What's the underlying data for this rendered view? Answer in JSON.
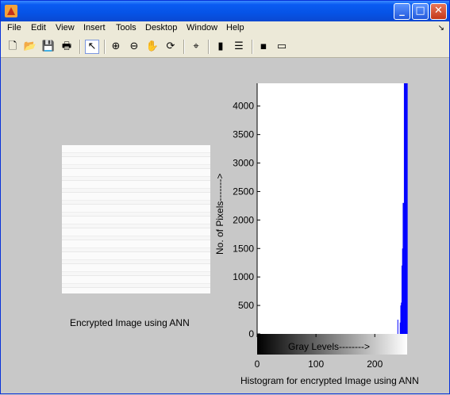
{
  "menu": {
    "items": [
      "File",
      "Edit",
      "View",
      "Insert",
      "Tools",
      "Desktop",
      "Window",
      "Help"
    ],
    "overflow_icon": "dock-arrow-icon"
  },
  "toolbar": {
    "tools": [
      "new-figure-icon",
      "open-file-icon",
      "save-icon",
      "print-icon",
      "select-arrow-icon",
      "zoom-in-icon",
      "zoom-out-icon",
      "pan-hand-icon",
      "rotate-3d-icon",
      "data-cursor-icon",
      "insert-colorbar-icon",
      "insert-legend-icon",
      "hide-plot-tools-icon",
      "show-plot-tools-icon"
    ]
  },
  "left_panel": {
    "caption": "Encrypted Image using ANN"
  },
  "chart_data": {
    "type": "bar",
    "title": "",
    "xlabel": "Gray Levels-------->",
    "ylabel": "No. of Pixels------->",
    "caption": "Histogram for encrypted Image using ANN",
    "xlim": [
      0,
      255
    ],
    "ylim": [
      0,
      4400
    ],
    "xticks": [
      0,
      100,
      200
    ],
    "yticks": [
      0,
      500,
      1000,
      1500,
      2000,
      2500,
      3000,
      3500,
      4000
    ],
    "bar_color": "#0000ff",
    "x": [
      239,
      243,
      244,
      245,
      246,
      247,
      248,
      249,
      250,
      251,
      252,
      253,
      254,
      255
    ],
    "values": [
      250,
      200,
      500,
      550,
      1200,
      1500,
      2300,
      2300,
      4400,
      4400,
      4400,
      4400,
      4400,
      4400
    ],
    "grid": false
  }
}
